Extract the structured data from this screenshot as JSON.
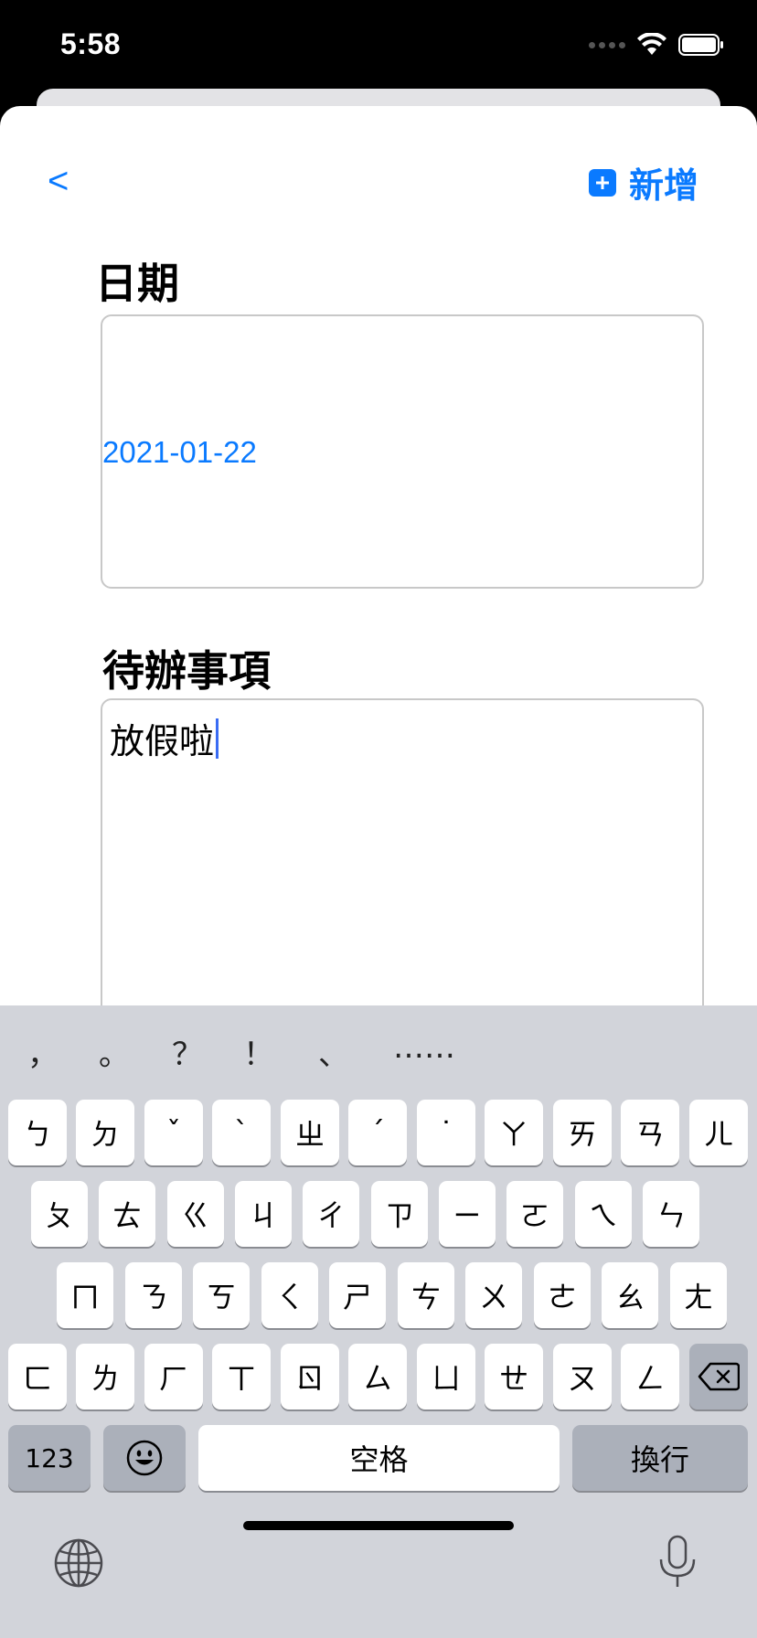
{
  "status": {
    "time": "5:58"
  },
  "nav": {
    "back_label": "<",
    "add_label": "新增"
  },
  "form": {
    "date_label": "日期",
    "date_value": "2021-01-22",
    "todo_label": "待辦事項",
    "todo_value": "放假啦"
  },
  "keyboard": {
    "suggestions": [
      "，",
      "。",
      "？",
      "！",
      "、",
      "……"
    ],
    "row1": [
      "ㄅ",
      "ㄉ",
      "ˇ",
      "ˋ",
      "ㄓ",
      "ˊ",
      "˙",
      "ㄚ",
      "ㄞ",
      "ㄢ",
      "ㄦ"
    ],
    "row2": [
      "ㄆ",
      "ㄊ",
      "ㄍ",
      "ㄐ",
      "ㄔ",
      "ㄗ",
      "ㄧ",
      "ㄛ",
      "ㄟ",
      "ㄣ"
    ],
    "row3": [
      "ㄇ",
      "ㄋ",
      "ㄎ",
      "ㄑ",
      "ㄕ",
      "ㄘ",
      "ㄨ",
      "ㄜ",
      "ㄠ",
      "ㄤ"
    ],
    "row4": [
      "ㄈ",
      "ㄌ",
      "ㄏ",
      "ㄒ",
      "ㄖ",
      "ㄙ",
      "ㄩ",
      "ㄝ",
      "ㄡ",
      "ㄥ"
    ],
    "numbers_label": "123",
    "space_label": "空格",
    "return_label": "換行"
  },
  "colors": {
    "accent": "#0a7aff",
    "keyboard_bg": "#d2d4da"
  }
}
